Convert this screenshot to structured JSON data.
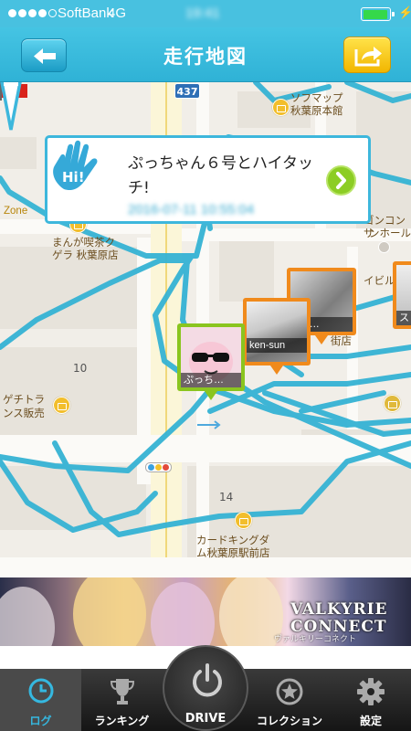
{
  "status_bar": {
    "carrier": "SoftBank",
    "network": "4G",
    "clock": "19:41",
    "battery_level": 0.95
  },
  "nav": {
    "title": "走行地図",
    "back_icon": "arrow-left-icon",
    "share_icon": "share-arrow-icon"
  },
  "map": {
    "route_number": "437",
    "labels": {
      "softmap": "ソフマップ",
      "softmap_store": "秋葉原本館",
      "zone": "Zone",
      "manga_cafe_1": "まんが喫茶ク",
      "manga_cafe_2": "ゲラ 秋葉原店",
      "concert_1": "ゴンコンサ",
      "concert_2": "ンホール",
      "ibil": "イビル",
      "shop_fragment": "街店",
      "bichi_1": "ゲチトラ",
      "bichi_2": "ンス販売",
      "card_kingdom_1": "カードキングダ",
      "card_kingdom_2": "ム秋葉原駅前店",
      "block_10": "10",
      "block_14": "14"
    }
  },
  "callout": {
    "icon": "hi-hand-icon",
    "message": "ぷっちゃん６号とハイタッチ!",
    "timestamp": "2016-07-11 10:55:04"
  },
  "markers": [
    {
      "label": "ぷっち…",
      "color": "#8ac51f"
    },
    {
      "label": "ken-sun",
      "color": "#f08a1c"
    },
    {
      "label": "l po…",
      "color": "#f08a1c"
    },
    {
      "label": "ス",
      "color": "#f08a1c"
    }
  ],
  "banner": {
    "title_line1": "VALKYRIE",
    "title_line2": "CONNECT",
    "subtitle": "ヴァルキリーコネクト"
  },
  "tabs": [
    {
      "label": "ログ",
      "icon": "clock-icon",
      "active": true
    },
    {
      "label": "ランキング",
      "icon": "trophy-icon",
      "active": false
    },
    {
      "label": "DRIVE",
      "icon": "power-icon",
      "active": false
    },
    {
      "label": "コレクション",
      "icon": "star-badge-icon",
      "active": false
    },
    {
      "label": "設定",
      "icon": "gear-icon",
      "active": false
    }
  ],
  "colors": {
    "accent": "#3db7dc",
    "route": "#35b3d4",
    "active_tab": "#35b8e0",
    "share_button": "#f5c400",
    "marker_green": "#8ac51f",
    "marker_orange": "#f08a1c"
  }
}
